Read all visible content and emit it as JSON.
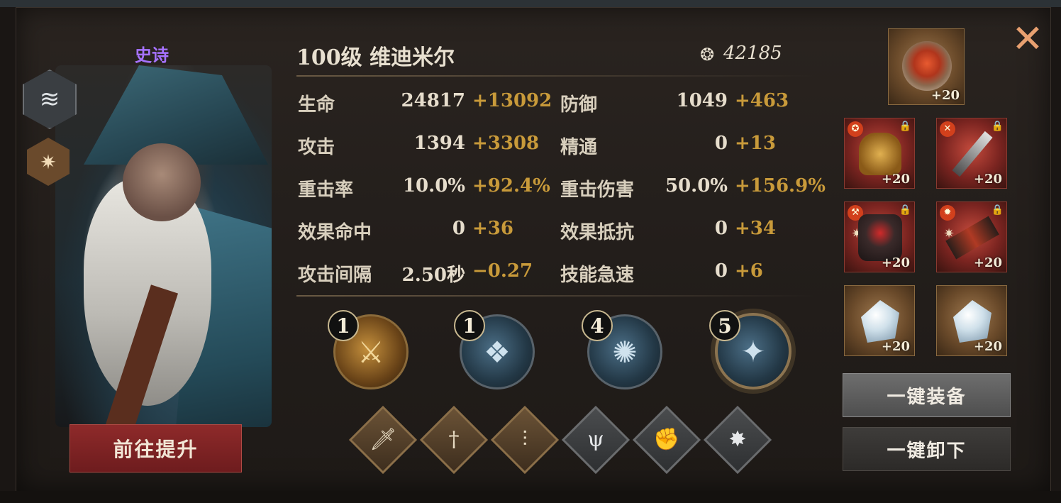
{
  "hero": {
    "rarity": "史诗",
    "title": "100级  维迪米尔",
    "power": "42185",
    "upgrade_label": "前往提升"
  },
  "stats": [
    {
      "label": "生命",
      "base": "24817",
      "bonus": "+13092"
    },
    {
      "label": "防御",
      "base": "1049",
      "bonus": "+463"
    },
    {
      "label": "攻击",
      "base": "1394",
      "bonus": "+3308"
    },
    {
      "label": "精通",
      "base": "0",
      "bonus": "+13"
    },
    {
      "label": "重击率",
      "base": "10.0%",
      "bonus": "+92.4%"
    },
    {
      "label": "重击伤害",
      "base": "50.0%",
      "bonus": "+156.9%"
    },
    {
      "label": "效果命中",
      "base": "0",
      "bonus": "+36"
    },
    {
      "label": "效果抵抗",
      "base": "0",
      "bonus": "+34"
    },
    {
      "label": "攻击间隔",
      "base": "2.50秒",
      "bonus": "−0.27"
    },
    {
      "label": "技能急速",
      "base": "0",
      "bonus": "+6"
    }
  ],
  "skills": [
    {
      "level": "1",
      "icon": "crossed-swords-icon"
    },
    {
      "level": "1",
      "icon": "shards-icon"
    },
    {
      "level": "4",
      "icon": "burst-icon"
    },
    {
      "level": "5",
      "icon": "vortex-icon"
    }
  ],
  "talents": [
    "sword-icon",
    "pedestal-sword-icon",
    "triple-sword-icon",
    "trident-icon",
    "fist-icon",
    "spikes-icon"
  ],
  "equipment": [
    {
      "slot": "accessory",
      "level": "+20"
    },
    {
      "slot": "helmet",
      "level": "+20"
    },
    {
      "slot": "weapon",
      "level": "+20"
    },
    {
      "slot": "armor",
      "level": "+20"
    },
    {
      "slot": "gloves",
      "level": "+20"
    },
    {
      "slot": "crystal-1",
      "level": "+20"
    },
    {
      "slot": "crystal-2",
      "level": "+20"
    }
  ],
  "buttons": {
    "equip_all": "一键装备",
    "unequip_all": "一键卸下"
  }
}
